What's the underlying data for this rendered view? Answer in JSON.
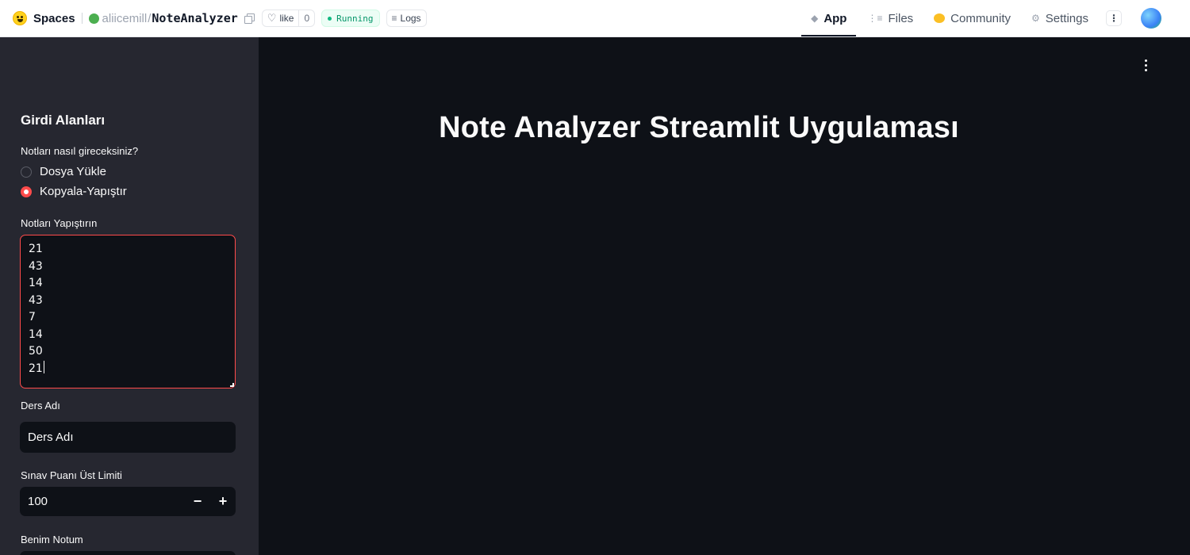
{
  "topbar": {
    "spaces_label": "Spaces",
    "owner": "aliicemill",
    "slash": "/",
    "repo": "NoteAnalyzer",
    "like_label": "like",
    "like_count": "0",
    "status": "Running",
    "logs_label": "Logs",
    "nav": {
      "app": "App",
      "files": "Files",
      "community": "Community",
      "settings": "Settings"
    }
  },
  "sidebar": {
    "title": "Girdi Alanları",
    "input_method_label": "Notları nasıl gireceksiniz?",
    "radio_options": [
      "Dosya Yükle",
      "Kopyala-Yapıştır"
    ],
    "selected_option": "Kopyala-Yapıştır",
    "paste_label": "Notları Yapıştırın",
    "paste_value": "21\n43\n14\n43\n7\n14\n50\n21",
    "course_label": "Ders Adı",
    "course_value": "Ders Adı",
    "limit_label": "Sınav Puanı Üst Limiti",
    "limit_value": "100",
    "stepper_minus": "−",
    "stepper_plus": "+",
    "my_grade_label": "Benim Notum"
  },
  "main": {
    "title": "Note Analyzer Streamlit Uygulaması"
  },
  "colors": {
    "accent": "#ff4b4b",
    "sidebar_bg": "#262730",
    "main_bg": "#0e1117",
    "running_green": "#10b981"
  },
  "icons": {
    "logo": "hugging-face-icon",
    "copy": "copy-icon",
    "like": "heart-icon",
    "logs": "lines-icon",
    "app": "cube-icon",
    "files": "files-icon",
    "community": "community-icon",
    "settings": "gear-icon",
    "more": "kebab-icon"
  }
}
